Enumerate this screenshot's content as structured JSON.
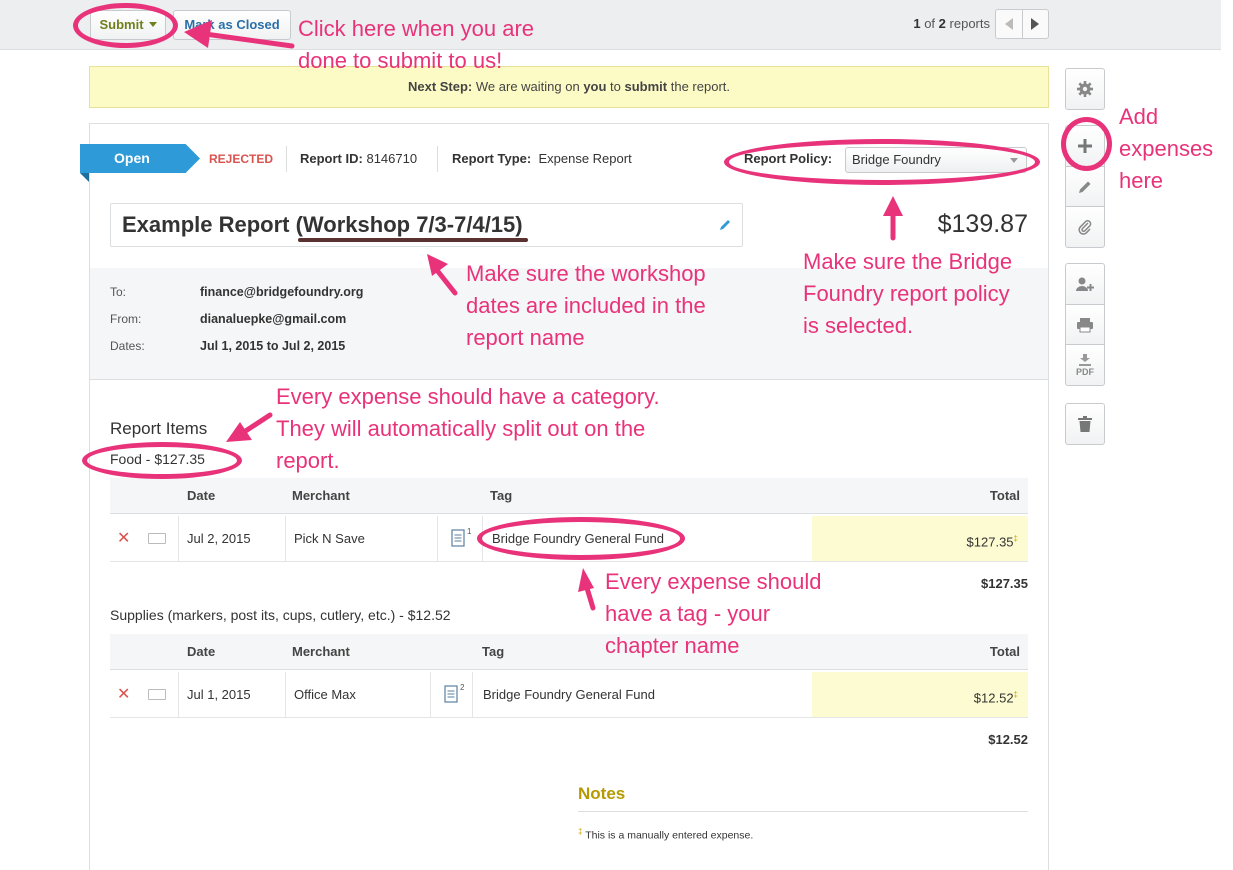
{
  "toolbar": {
    "submit_label": "Submit",
    "close_label": "Mark as Closed",
    "pager_current": "1",
    "pager_of": "of",
    "pager_total": "2",
    "pager_suffix": "reports"
  },
  "banner": {
    "prefix": "Next Step:",
    "t1": " We are waiting on ",
    "you": "you",
    "t2": " to ",
    "submit": "submit",
    "t3": " the report."
  },
  "report": {
    "status": "Open",
    "rejected": "REJECTED",
    "id_label": "Report ID:",
    "id_value": "8146710",
    "type_label": "Report Type:",
    "type_value": "Expense Report",
    "policy_label": "Report Policy:",
    "policy_value": "Bridge Foundry",
    "title": "Example Report (Workshop 7/3-7/4/15)",
    "amount": "$139.87"
  },
  "meta": {
    "to_label": "To:",
    "to_value": "finance@bridgefoundry.org",
    "from_label": "From:",
    "from_value": "dianaluepke@gmail.com",
    "dates_label": "Dates:",
    "dates_value": "Jul 1, 2015 to Jul 2, 2015"
  },
  "items": {
    "section_title": "Report Items",
    "headers": {
      "date": "Date",
      "merchant": "Merchant",
      "tag": "Tag",
      "total": "Total"
    },
    "categories": [
      {
        "title": "Food - $127.35",
        "subtotal": "$127.35",
        "row": {
          "date": "Jul 2, 2015",
          "merchant": "Pick N Save",
          "receipt": "1",
          "tag": "Bridge Foundry General Fund",
          "total": "$127.35",
          "mark": "‡"
        }
      },
      {
        "title": "Supplies (markers, post its, cups, cutlery, etc.) - $12.52",
        "subtotal": "$12.52",
        "row": {
          "date": "Jul 1, 2015",
          "merchant": "Office Max",
          "receipt": "2",
          "tag": "Bridge Foundry General Fund",
          "total": "$12.52",
          "mark": "‡"
        }
      }
    ]
  },
  "notes": {
    "title": "Notes",
    "mark": "‡",
    "text": "This is a manually entered expense."
  },
  "rail": {
    "pdf_label": "PDF"
  },
  "annotations": {
    "submit": [
      "Click here when you are",
      "done to submit to us!"
    ],
    "add": [
      "Add",
      "expenses",
      "here"
    ],
    "workshop": [
      "Make sure the workshop",
      "dates are included in the",
      "report name"
    ],
    "policy": [
      "Make sure the Bridge",
      "Foundry report policy",
      "is selected."
    ],
    "category": [
      "Every expense should have a category.",
      "They will automatically split out on the",
      "report."
    ],
    "tag": [
      "Every expense should",
      "have a tag - your",
      "chapter name"
    ]
  },
  "colors": {
    "annotation": "#e8337a",
    "status_blue": "#2e9ad7",
    "rejected": "#d9534f",
    "banner": "#fdfbc5",
    "notes": "#b69a00"
  }
}
